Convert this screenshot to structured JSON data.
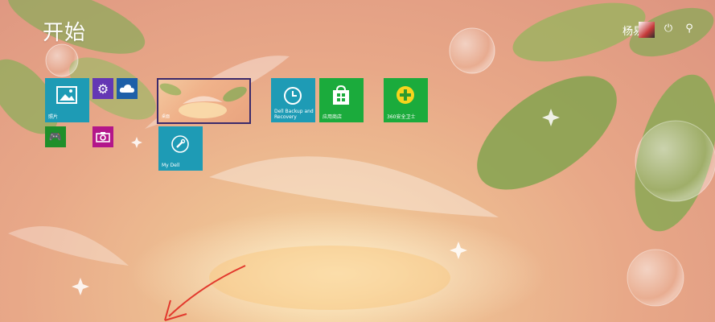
{
  "start": {
    "title": "开始"
  },
  "user": {
    "name": "杨易青"
  },
  "icons": {
    "power": "power-icon",
    "search": "search-icon"
  },
  "tiles": {
    "photos": "照片",
    "dell_backup": "Dell Backup and Recovery",
    "store": "应用商店",
    "safe360": "360安全卫士",
    "mydell": "My Dell",
    "desktop_label": "桌面"
  },
  "colors": {
    "accent_teal": "#1e9bb5",
    "store_green": "#1bab3c",
    "settings_purple": "#6437b4",
    "camera_magenta": "#b3168a",
    "onedrive_blue": "#1d5fa8"
  }
}
